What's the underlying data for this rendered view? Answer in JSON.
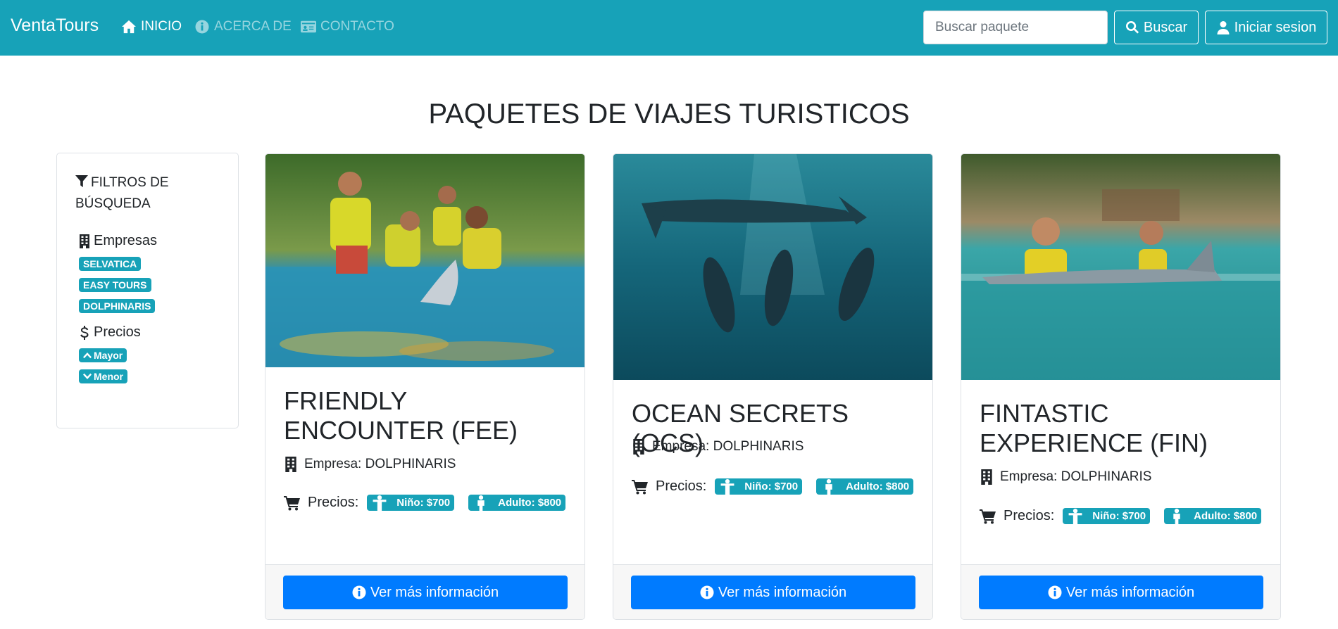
{
  "navbar": {
    "brand": "VentaTours",
    "links": [
      {
        "label": "INICIO",
        "icon": "home-icon",
        "active": true
      },
      {
        "label": "ACERCA DE",
        "icon": "info-circle-icon",
        "active": false
      },
      {
        "label": "CONTACTO",
        "icon": "id-card-icon",
        "active": false
      }
    ],
    "search_placeholder": "Buscar paquete",
    "search_button": "Buscar",
    "login_button": "Iniciar sesion"
  },
  "page_title": "PAQUETES DE VIAJES TURISTICOS",
  "filters": {
    "heading": "FILTROS DE BÚSQUEDA",
    "companies_label": "Empresas",
    "companies": [
      "SELVATICA",
      "EASY TOURS",
      "DOLPHINARIS"
    ],
    "prices_label": "Precios",
    "price_options": [
      "Mayor",
      "Menor"
    ]
  },
  "cards": [
    {
      "title": "FRIENDLY ENCOUNTER (FEE)",
      "company_label": "Empresa:",
      "company": "DOLPHINARIS",
      "prices_label": "Precios:",
      "child_price": "Niño: $700",
      "adult_price": "Adulto: $800",
      "button": "Ver más información"
    },
    {
      "title": "OCEAN SECRETS (OCS)",
      "company_label": "Empresa:",
      "company": "DOLPHINARIS",
      "prices_label": "Precios:",
      "child_price": "Niño: $700",
      "adult_price": "Adulto: $800",
      "button": "Ver más información"
    },
    {
      "title": "FINTASTIC EXPERIENCE (FIN)",
      "company_label": "Empresa:",
      "company": "DOLPHINARIS",
      "prices_label": "Precios:",
      "child_price": "Niño: $700",
      "adult_price": "Adulto: $800",
      "button": "Ver más información"
    }
  ],
  "colors": {
    "navbar": "#17a2b8",
    "badge": "#17a2b8",
    "primary_button": "#007bff"
  }
}
